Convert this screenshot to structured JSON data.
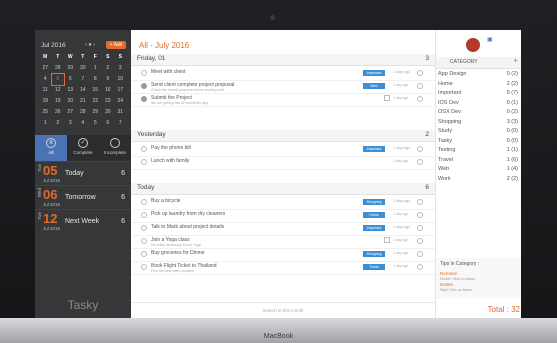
{
  "device_label": "MacBook",
  "sidebar": {
    "calendar_title": "Jul 2016",
    "nav": "‹ ● ›",
    "add_label": "+ Add",
    "weekdays": [
      "M",
      "T",
      "W",
      "T",
      "F",
      "S",
      "S"
    ],
    "weeks": [
      [
        "27",
        "28",
        "29",
        "30",
        "1",
        "2",
        "3"
      ],
      [
        "4",
        "5",
        "6",
        "7",
        "8",
        "9",
        "10"
      ],
      [
        "11",
        "12",
        "13",
        "14",
        "15",
        "16",
        "17"
      ],
      [
        "18",
        "19",
        "20",
        "21",
        "22",
        "23",
        "24"
      ],
      [
        "25",
        "26",
        "27",
        "28",
        "29",
        "30",
        "31"
      ],
      [
        "1",
        "2",
        "3",
        "4",
        "5",
        "6",
        "7"
      ]
    ],
    "filters": [
      {
        "label": "All",
        "icon": "list-icon",
        "active": true
      },
      {
        "label": "Complete",
        "icon": "check-icon",
        "active": false
      },
      {
        "label": "Incomplete",
        "icon": "circle-icon",
        "active": false
      }
    ],
    "days": [
      {
        "dow": "Tue",
        "num": "05",
        "mon": "Jul 2016",
        "name": "Today",
        "count": "6"
      },
      {
        "dow": "Wed",
        "num": "06",
        "mon": "Jul 2016",
        "name": "Tomorrow",
        "count": "6"
      },
      {
        "dow": "Tue",
        "num": "12",
        "mon": "Jul 2016",
        "name": "Next Week",
        "count": "6"
      }
    ],
    "app_name": "Tasky"
  },
  "main": {
    "title": "All - July 2016",
    "sections": [
      {
        "title": "Friday, 01",
        "count": "3",
        "tasks": [
          {
            "title": "Meet with client",
            "sub": "",
            "cat": "Important",
            "ago": "2 days ago",
            "done": false,
            "note": false
          },
          {
            "title": "Send client complete project proposal",
            "sub": "Check the overall proposal before sending mail.",
            "cat": "Web",
            "ago": "1 day ago",
            "done": true,
            "note": false
          },
          {
            "title": "Submit the Project",
            "sub": "We are getting late to submit the app",
            "cat": "",
            "ago": "1 day ago",
            "done": true,
            "note": true
          }
        ]
      },
      {
        "title": "Yesterday",
        "count": "2",
        "tasks": [
          {
            "title": "Pay the phone bill",
            "sub": "",
            "cat": "Important",
            "ago": "2 days ago",
            "done": false,
            "note": false
          },
          {
            "title": "Lunch with family",
            "sub": "",
            "cat": "",
            "ago": "1 day ago",
            "done": false,
            "note": false
          }
        ]
      },
      {
        "title": "Today",
        "count": "6",
        "tasks": [
          {
            "title": "Buy a bicycle",
            "sub": "",
            "cat": "Shopping",
            "ago": "2 days ago",
            "done": false,
            "note": false
          },
          {
            "title": "Pick up laundry from dry cleaners",
            "sub": "",
            "cat": "Home",
            "ago": "1 day ago",
            "done": false,
            "note": false
          },
          {
            "title": "Talk to Mark about project details",
            "sub": "",
            "cat": "Important",
            "ago": "2 days ago",
            "done": false,
            "note": false
          },
          {
            "title": "Join a Yoga class",
            "sub": "It's really necessary to join Yoga",
            "cat": "",
            "ago": "1 day ago",
            "done": false,
            "note": true
          },
          {
            "title": "Buy groceries for Dinner",
            "sub": "",
            "cat": "Shopping",
            "ago": "1 day ago",
            "done": false,
            "note": false
          },
          {
            "title": "Book Flight Ticket to Thailand",
            "sub": "Find the best rates possible",
            "cat": "Travel",
            "ago": "1 day ago",
            "done": false,
            "note": false
          }
        ]
      }
    ],
    "search_placeholder": "Search in this month"
  },
  "right": {
    "category_title": "CATEGORY",
    "categories": [
      {
        "name": "App Design",
        "value": "0 (2)"
      },
      {
        "name": "Home",
        "value": "2 (2)"
      },
      {
        "name": "Important",
        "value": "5 (7)"
      },
      {
        "name": "IOS Dev",
        "value": "0 (1)"
      },
      {
        "name": "OSX Dev",
        "value": "0 (2)"
      },
      {
        "name": "Shopping",
        "value": "3 (3)"
      },
      {
        "name": "Study",
        "value": "0 (0)"
      },
      {
        "name": "Tasky",
        "value": "0 (0)"
      },
      {
        "name": "Testing",
        "value": "1 (1)"
      },
      {
        "name": "Travel",
        "value": "1 (6)"
      },
      {
        "name": "Web",
        "value": "1 (4)"
      },
      {
        "name": "Work",
        "value": "2 (2)"
      }
    ],
    "tips_title": "Tips in Category :",
    "tips": [
      {
        "label": "Rename",
        "sub": "Double Click on Name"
      },
      {
        "label": "Delete",
        "sub": "Right Click on Name"
      }
    ],
    "total": "Total : 32"
  },
  "colors": {
    "accent": "#e46a2a",
    "sidebar": "#363739",
    "tag": "#3e8ed6"
  }
}
